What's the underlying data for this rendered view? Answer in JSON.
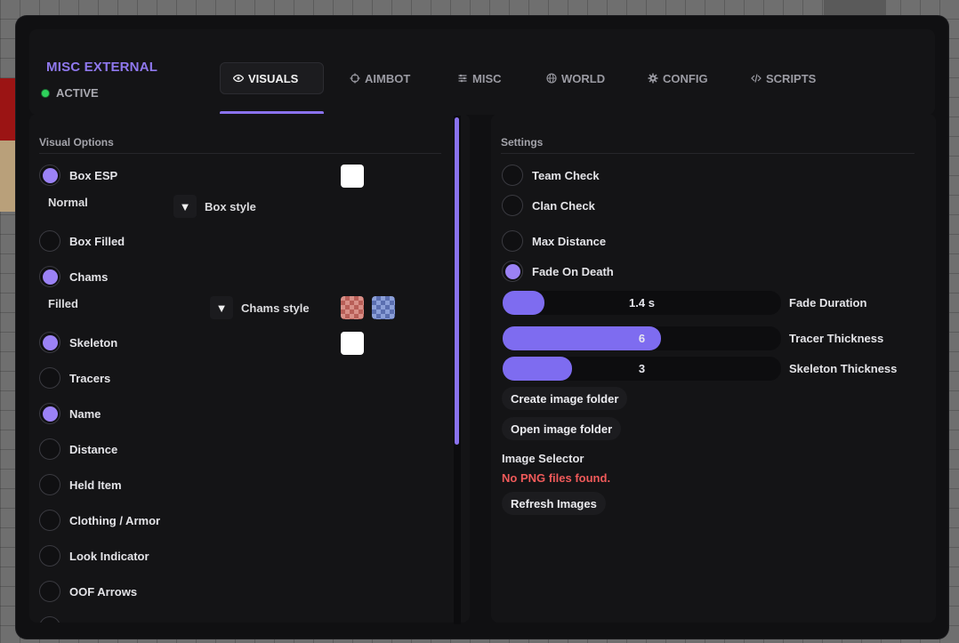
{
  "brand": {
    "title": "MISC EXTERNAL",
    "status": "ACTIVE"
  },
  "tabs": [
    {
      "label": "VISUALS",
      "icon": "eye-icon"
    },
    {
      "label": "AIMBOT",
      "icon": "crosshair-icon"
    },
    {
      "label": "MISC",
      "icon": "sliders-icon"
    },
    {
      "label": "WORLD",
      "icon": "globe-icon"
    },
    {
      "label": "CONFIG",
      "icon": "gear-icon"
    },
    {
      "label": "SCRIPTS",
      "icon": "code-icon"
    }
  ],
  "visual_options": {
    "title": "Visual Options",
    "box_esp": {
      "label": "Box ESP",
      "on": true
    },
    "box_style": {
      "value": "Normal",
      "label": "Box style"
    },
    "box_filled": {
      "label": "Box Filled",
      "on": false
    },
    "chams": {
      "label": "Chams",
      "on": true
    },
    "chams_style": {
      "value": "Filled",
      "label": "Chams style"
    },
    "skeleton": {
      "label": "Skeleton",
      "on": true
    },
    "tracers": {
      "label": "Tracers",
      "on": false
    },
    "name": {
      "label": "Name",
      "on": true
    },
    "distance": {
      "label": "Distance",
      "on": false
    },
    "held_item": {
      "label": "Held Item",
      "on": false
    },
    "clothing": {
      "label": "Clothing / Armor",
      "on": false
    },
    "look_indicator": {
      "label": "Look Indicator",
      "on": false
    },
    "oof_arrows": {
      "label": "OOF Arrows",
      "on": false
    },
    "colors": {
      "box": "#ffffff",
      "skeleton": "#ffffff",
      "chams_fill": "#d88f87",
      "chams_outline": "#8b9fd8"
    }
  },
  "settings": {
    "title": "Settings",
    "team_check": {
      "label": "Team Check",
      "on": false
    },
    "clan_check": {
      "label": "Clan Check",
      "on": false
    },
    "max_distance": {
      "label": "Max Distance",
      "on": false
    },
    "fade_on_death": {
      "label": "Fade On Death",
      "on": true
    },
    "fade_duration": {
      "label": "Fade Duration",
      "display": "1.4 s",
      "fraction": 0.15
    },
    "tracer_thickness": {
      "label": "Tracer Thickness",
      "display": "6",
      "fraction": 0.57
    },
    "skeleton_thickness": {
      "label": "Skeleton Thickness",
      "display": "3",
      "fraction": 0.25
    },
    "create_folder": "Create image folder",
    "open_folder": "Open image folder",
    "image_selector": "Image Selector",
    "no_files": "No PNG files found.",
    "refresh": "Refresh Images"
  },
  "theme": {
    "accent": "#8a72ee",
    "error": "#f05a5a",
    "active_dot": "#2fd15b"
  }
}
